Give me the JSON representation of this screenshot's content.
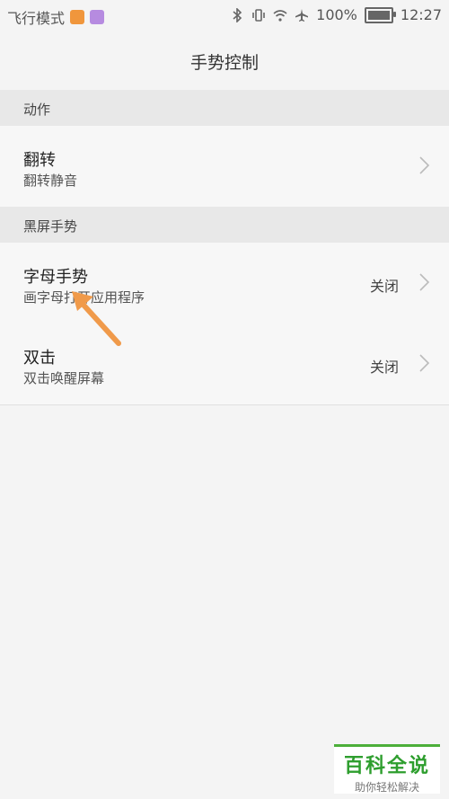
{
  "status": {
    "mode": "飞行模式",
    "battery": "100%",
    "time": "12:27"
  },
  "header": {
    "title": "手势控制"
  },
  "sections": [
    {
      "label": "动作"
    },
    {
      "label": "黑屏手势"
    }
  ],
  "rows": [
    {
      "title": "翻转",
      "subtitle": "翻转静音",
      "status": ""
    },
    {
      "title": "字母手势",
      "subtitle": "画字母打开应用程序",
      "status": "关闭"
    },
    {
      "title": "双击",
      "subtitle": "双击唤醒屏幕",
      "status": "关闭"
    }
  ],
  "watermark": {
    "title": "百科全说",
    "subtitle": "助你轻松解决"
  },
  "colors": {
    "accent_arrow": "#f09a4a",
    "watermark_green": "#2e9e2e"
  }
}
